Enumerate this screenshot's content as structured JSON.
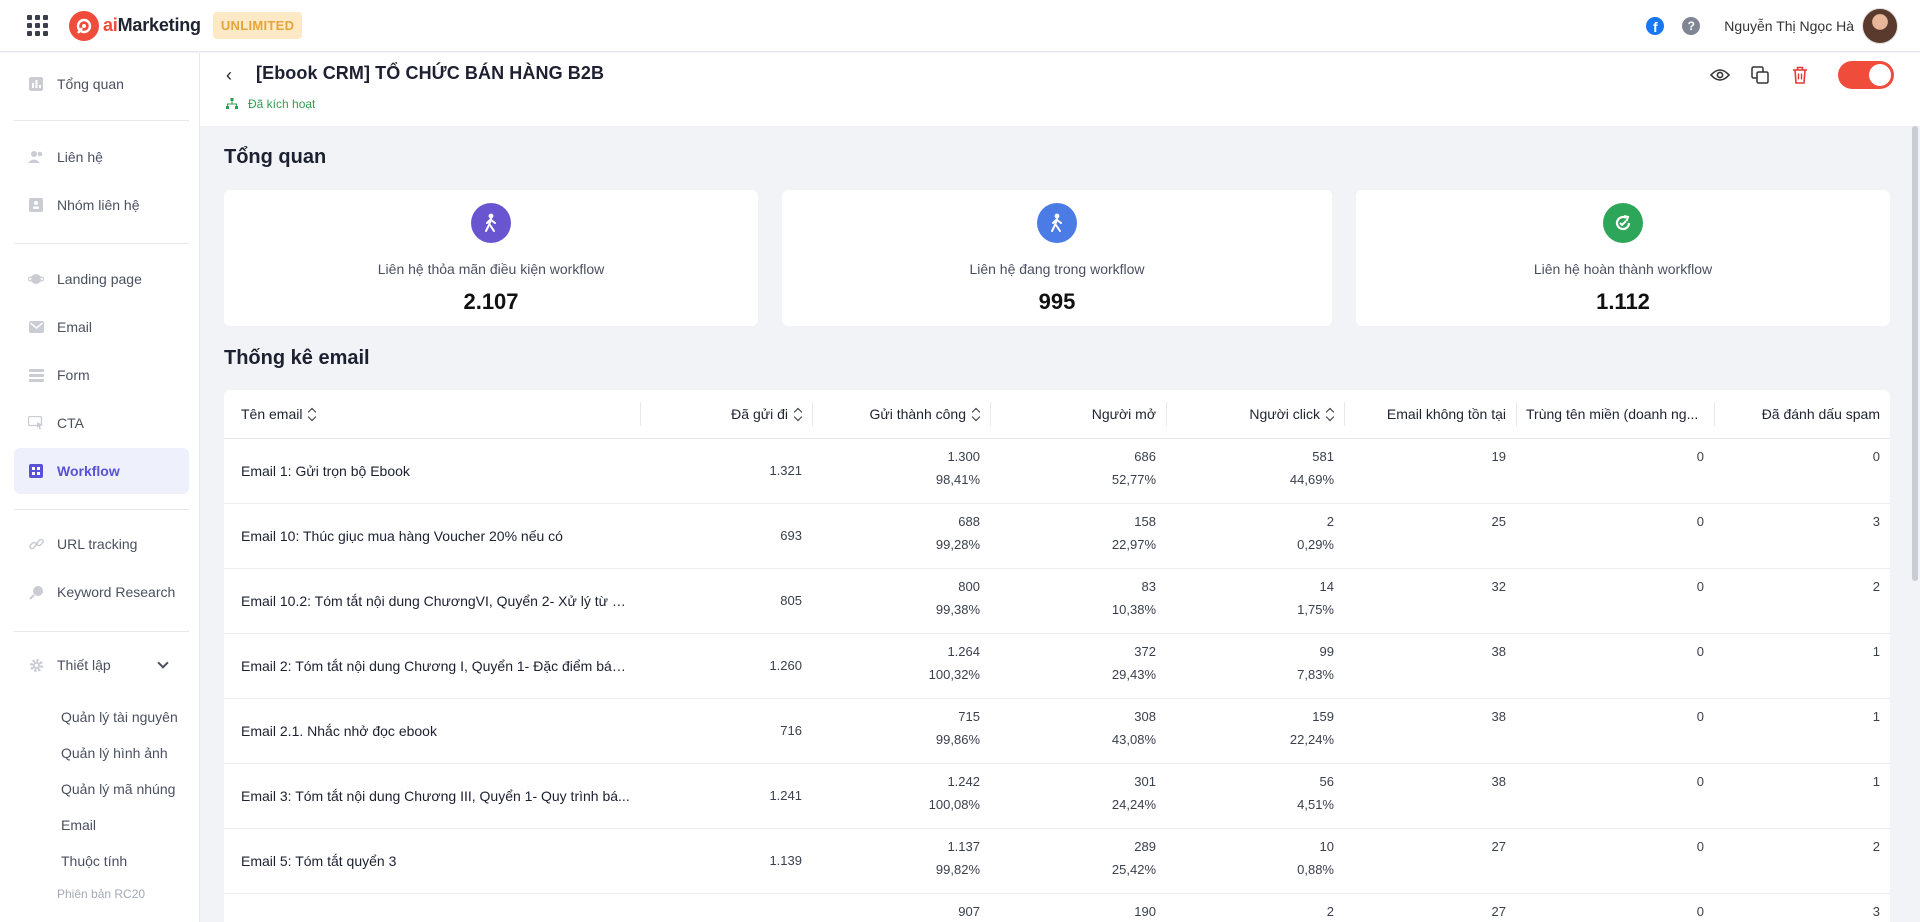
{
  "app": {
    "brand_ai": "ai",
    "brand_rest": "Marketing",
    "plan_badge": "UNLIMITED",
    "user_name": "Nguyễn Thị Ngọc Hà"
  },
  "sidebar": {
    "items": [
      {
        "label": "Tổng quan",
        "icon": "chart-bar-icon"
      },
      {
        "label": "Liên hệ",
        "icon": "users-icon"
      },
      {
        "label": "Nhóm liên hệ",
        "icon": "contact-group-icon"
      },
      {
        "label": "Landing page",
        "icon": "planet-icon"
      },
      {
        "label": "Email",
        "icon": "mail-icon"
      },
      {
        "label": "Form",
        "icon": "form-icon"
      },
      {
        "label": "CTA",
        "icon": "cursor-icon"
      },
      {
        "label": "Workflow",
        "icon": "workflow-icon"
      },
      {
        "label": "URL tracking",
        "icon": "link-icon"
      },
      {
        "label": "Keyword Research",
        "icon": "keyword-icon"
      },
      {
        "label": "Thiết lập",
        "icon": "gear-icon"
      }
    ],
    "sub_items": [
      "Quản lý tài nguyên",
      "Quản lý hình ảnh",
      "Quản lý mã nhúng",
      "Email",
      "Thuộc tính"
    ],
    "version": "Phiên bản RC20"
  },
  "header": {
    "back": "‹",
    "title": "[Ebook CRM] TỔ CHỨC BÁN HÀNG B2B",
    "status": "Đã kích hoạt",
    "active_toggle": true
  },
  "overview": {
    "title": "Tổng quan",
    "cards": [
      {
        "label": "Liên hệ thỏa mãn điều kiện workflow",
        "value": "2.107",
        "color": "#6a55d1"
      },
      {
        "label": "Liên hệ đang trong workflow",
        "value": "995",
        "color": "#4b7be5"
      },
      {
        "label": "Liên hệ hoàn thành workflow",
        "value": "1.112",
        "color": "#2ea65a"
      }
    ]
  },
  "email_stats": {
    "title": "Thống kê email",
    "columns": [
      "Tên email",
      "Đã gửi đi",
      "Gửi thành công",
      "Người mở",
      "Người click",
      "Email không tồn tại",
      "Trùng tên miền (doanh ng...",
      "Đã đánh dấu spam"
    ],
    "rows": [
      {
        "name": "Email 1: Gửi trọn bộ Ebook",
        "sent": "1.321",
        "success": "1.300",
        "success_pct": "98,41%",
        "open": "686",
        "open_pct": "52,77%",
        "click": "581",
        "click_pct": "44,69%",
        "invalid": "19",
        "domain": "0",
        "spam": "0"
      },
      {
        "name": "Email 10: Thúc giục mua hàng Voucher 20% nếu có",
        "sent": "693",
        "success": "688",
        "success_pct": "99,28%",
        "open": "158",
        "open_pct": "22,97%",
        "click": "2",
        "click_pct": "0,29%",
        "invalid": "25",
        "domain": "0",
        "spam": "3"
      },
      {
        "name": "Email 10.2: Tóm tắt nội dung ChươngVI, Quyển 2- Xử lý từ ch...",
        "sent": "805",
        "success": "800",
        "success_pct": "99,38%",
        "open": "83",
        "open_pct": "10,38%",
        "click": "14",
        "click_pct": "1,75%",
        "invalid": "32",
        "domain": "0",
        "spam": "2"
      },
      {
        "name": "Email 2: Tóm tắt nội dung Chương I, Quyển 1- Đặc điểm bán ...",
        "sent": "1.260",
        "success": "1.264",
        "success_pct": "100,32%",
        "open": "372",
        "open_pct": "29,43%",
        "click": "99",
        "click_pct": "7,83%",
        "invalid": "38",
        "domain": "0",
        "spam": "1"
      },
      {
        "name": "Email 2.1. Nhắc nhở đọc ebook",
        "sent": "716",
        "success": "715",
        "success_pct": "99,86%",
        "open": "308",
        "open_pct": "43,08%",
        "click": "159",
        "click_pct": "22,24%",
        "invalid": "38",
        "domain": "0",
        "spam": "1"
      },
      {
        "name": "Email 3: Tóm tắt nội dung Chương III, Quyển 1- Quy trình bá...",
        "sent": "1.241",
        "success": "1.242",
        "success_pct": "100,08%",
        "open": "301",
        "open_pct": "24,24%",
        "click": "56",
        "click_pct": "4,51%",
        "invalid": "38",
        "domain": "0",
        "spam": "1"
      },
      {
        "name": "Email 5: Tóm tắt quyển 3",
        "sent": "1.139",
        "success": "1.137",
        "success_pct": "99,82%",
        "open": "289",
        "open_pct": "25,42%",
        "click": "10",
        "click_pct": "0,88%",
        "invalid": "27",
        "domain": "0",
        "spam": "2"
      },
      {
        "name": "",
        "sent": "",
        "success": "907",
        "success_pct": "",
        "open": "190",
        "open_pct": "",
        "click": "2",
        "click_pct": "",
        "invalid": "27",
        "domain": "0",
        "spam": "3"
      }
    ]
  }
}
